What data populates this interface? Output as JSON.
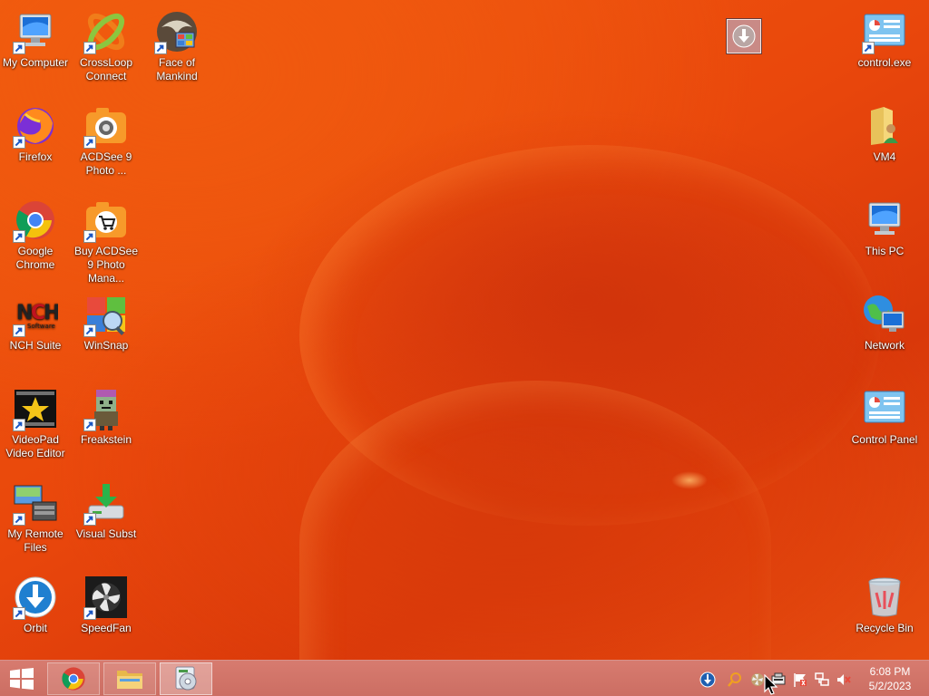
{
  "desktop": {
    "left_icons": [
      {
        "label": "My Computer",
        "icon": "computer-icon"
      },
      {
        "label": "CrossLoop Connect",
        "icon": "crossloop-icon"
      },
      {
        "label": "Face of Mankind",
        "icon": "face-of-mankind-icon"
      },
      {
        "label": "Firefox",
        "icon": "firefox-icon"
      },
      {
        "label": "ACDSee 9 Photo ...",
        "icon": "acdsee-icon"
      },
      {
        "label": "Google Chrome",
        "icon": "chrome-icon"
      },
      {
        "label": "Buy ACDSee 9 Photo Mana...",
        "icon": "acdsee-buy-icon"
      },
      {
        "label": "NCH Suite",
        "icon": "nch-suite-icon"
      },
      {
        "label": "WinSnap",
        "icon": "winsnap-icon"
      },
      {
        "label": "VideoPad Video Editor",
        "icon": "videopad-icon"
      },
      {
        "label": "Freakstein",
        "icon": "freakstein-icon"
      },
      {
        "label": "My Remote Files",
        "icon": "remote-files-icon"
      },
      {
        "label": "Visual Subst",
        "icon": "visual-subst-icon"
      },
      {
        "label": "Orbit",
        "icon": "orbit-icon"
      },
      {
        "label": "SpeedFan",
        "icon": "speedfan-icon"
      }
    ],
    "right_icons": [
      {
        "label": "control.exe",
        "icon": "control-panel-icon"
      },
      {
        "label": "VM4",
        "icon": "folder-user-icon"
      },
      {
        "label": "This PC",
        "icon": "computer-icon"
      },
      {
        "label": "Network",
        "icon": "network-icon"
      },
      {
        "label": "Control Panel",
        "icon": "control-panel-icon"
      },
      {
        "label": "Recycle Bin",
        "icon": "recycle-bin-icon"
      }
    ]
  },
  "taskbar": {
    "pinned": [
      {
        "name": "Google Chrome",
        "icon": "chrome-icon"
      },
      {
        "name": "File Explorer",
        "icon": "file-explorer-icon"
      },
      {
        "name": "Visual Subst",
        "icon": "disk-icon"
      }
    ],
    "tray": [
      "orbit-download-icon",
      "search-icon",
      "speedfan-tray-icon",
      "device-icon",
      "action-center-flag-icon",
      "network-tray-icon",
      "volume-muted-icon"
    ],
    "clock": {
      "time": "6:08 PM",
      "date": "5/2/2023"
    }
  },
  "colors": {
    "wallpaper": "#e9470c",
    "taskbar": "#d77b6f"
  }
}
